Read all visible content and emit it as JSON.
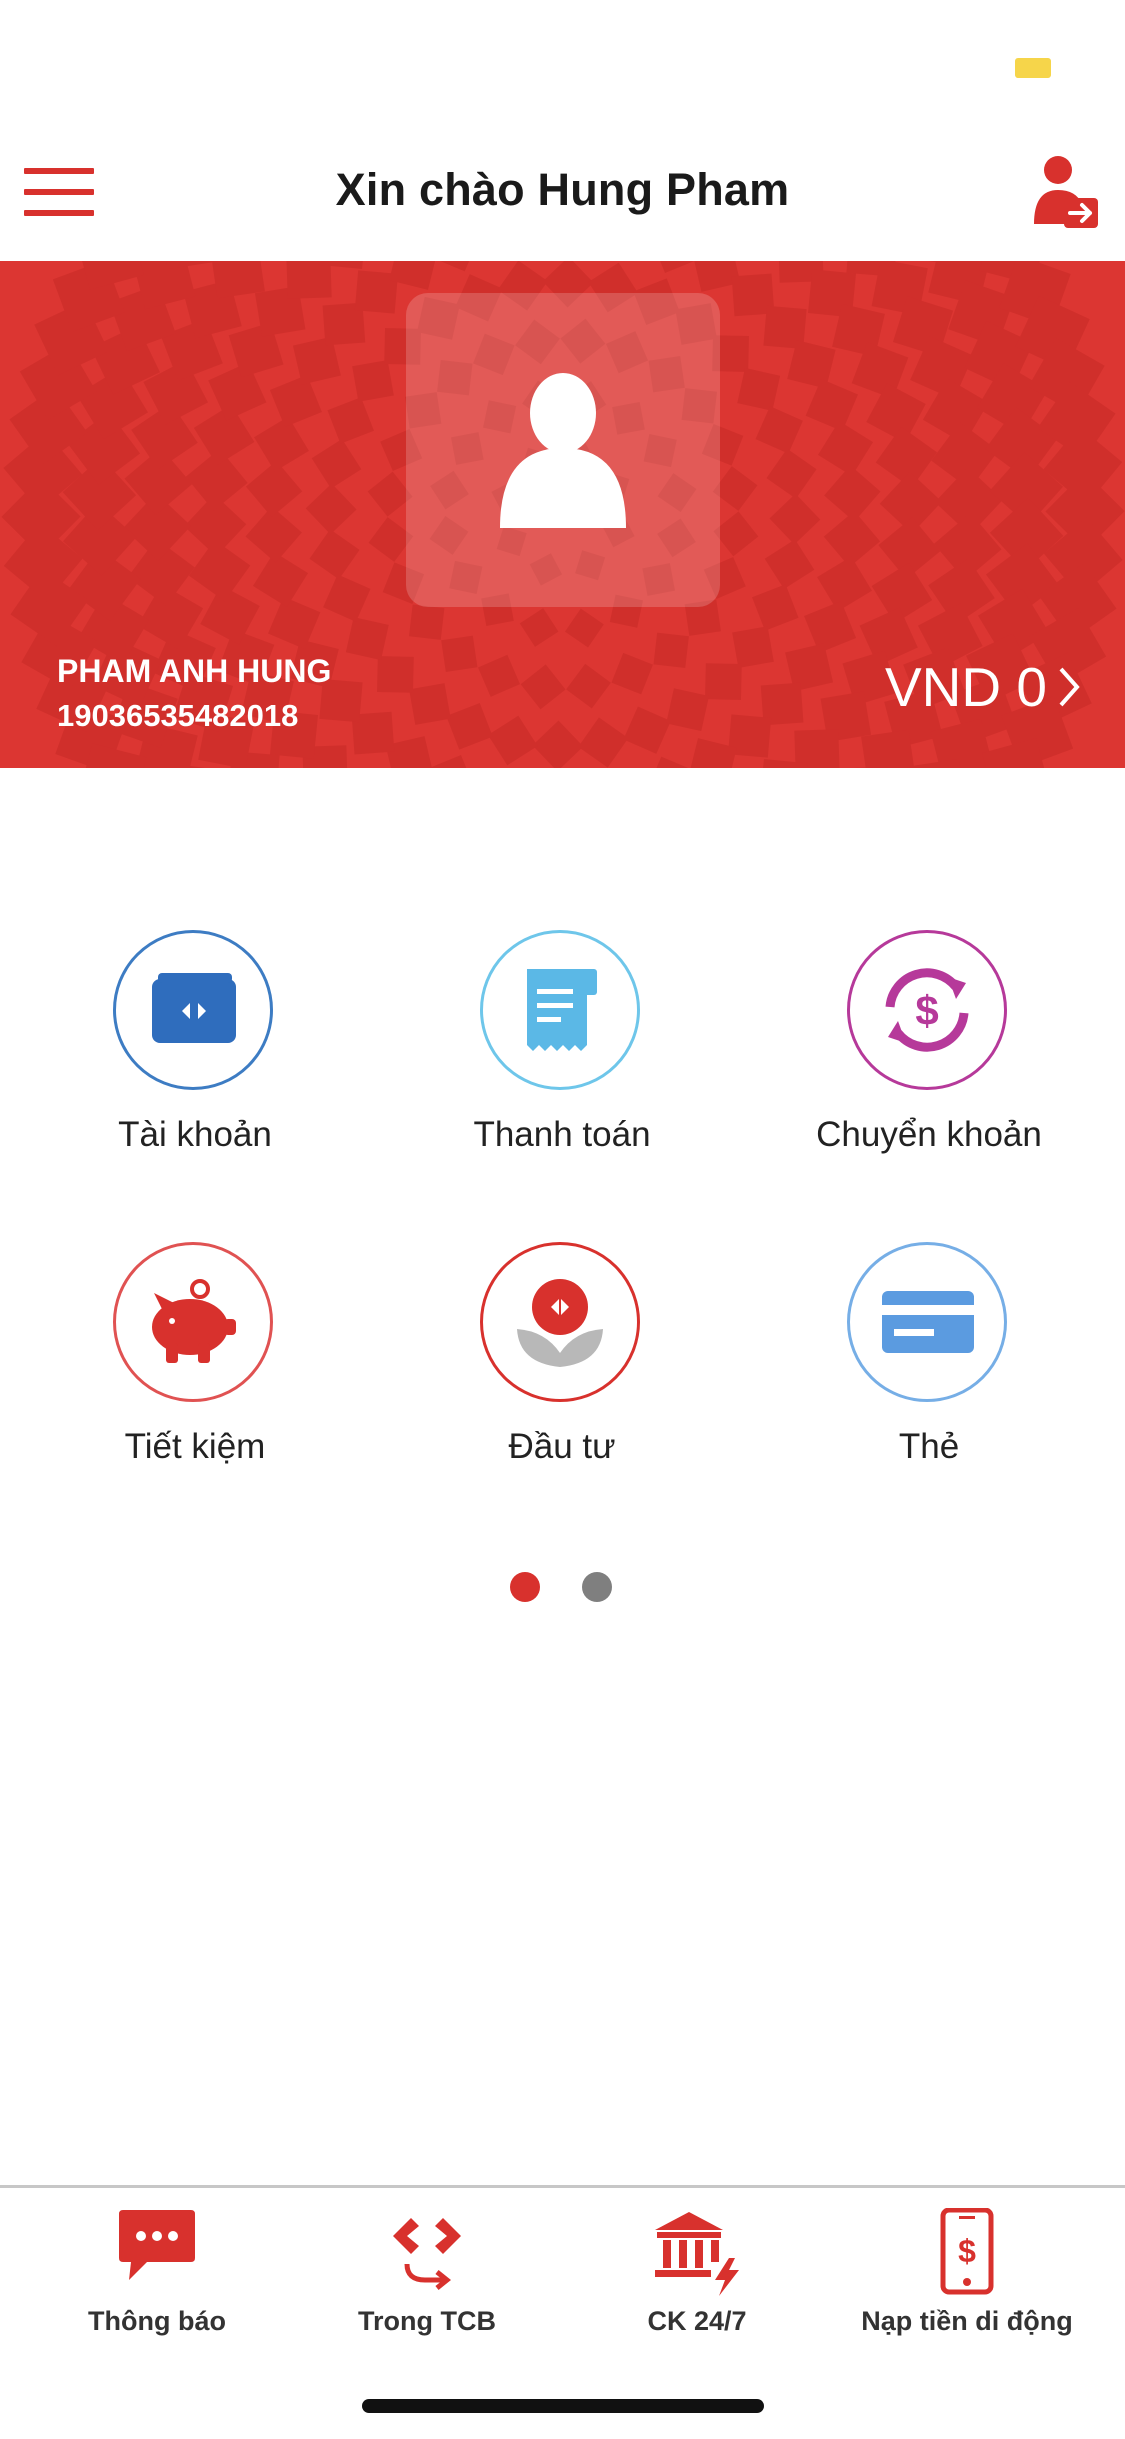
{
  "header": {
    "title": "Xin chào Hung Pham"
  },
  "account": {
    "holder_name": "PHAM ANH HUNG",
    "account_number": "19036535482018",
    "balance": "VND 0"
  },
  "menu_items": [
    {
      "label": "Tài khoản",
      "icon": "wallet-icon",
      "border": "#3d7cc3"
    },
    {
      "label": "Thanh toán",
      "icon": "receipt-icon",
      "border": "#6ec6ea"
    },
    {
      "label": "Chuyển khoản",
      "icon": "transfer-icon",
      "border": "#b6399a"
    },
    {
      "label": "Tiết kiệm",
      "icon": "piggy-bank-icon",
      "border": "#e05252"
    },
    {
      "label": "Đầu tư",
      "icon": "invest-icon",
      "border": "#d8312d"
    },
    {
      "label": "Thẻ",
      "icon": "card-icon",
      "border": "#76aee6"
    }
  ],
  "pager": {
    "total": 2,
    "active": 1,
    "active_color": "#d8312d",
    "inactive_color": "#7f7f7f"
  },
  "tabbar": [
    {
      "label": "Thông báo",
      "icon": "chat-icon"
    },
    {
      "label": "Trong TCB",
      "icon": "tcb-transfer-icon"
    },
    {
      "label": "CK 24/7",
      "icon": "bank-icon"
    },
    {
      "label": "Nạp tiền di động",
      "icon": "mobile-topup-icon"
    }
  ],
  "colors": {
    "brand_red": "#d8312d",
    "banner_red": "#dc3632"
  }
}
